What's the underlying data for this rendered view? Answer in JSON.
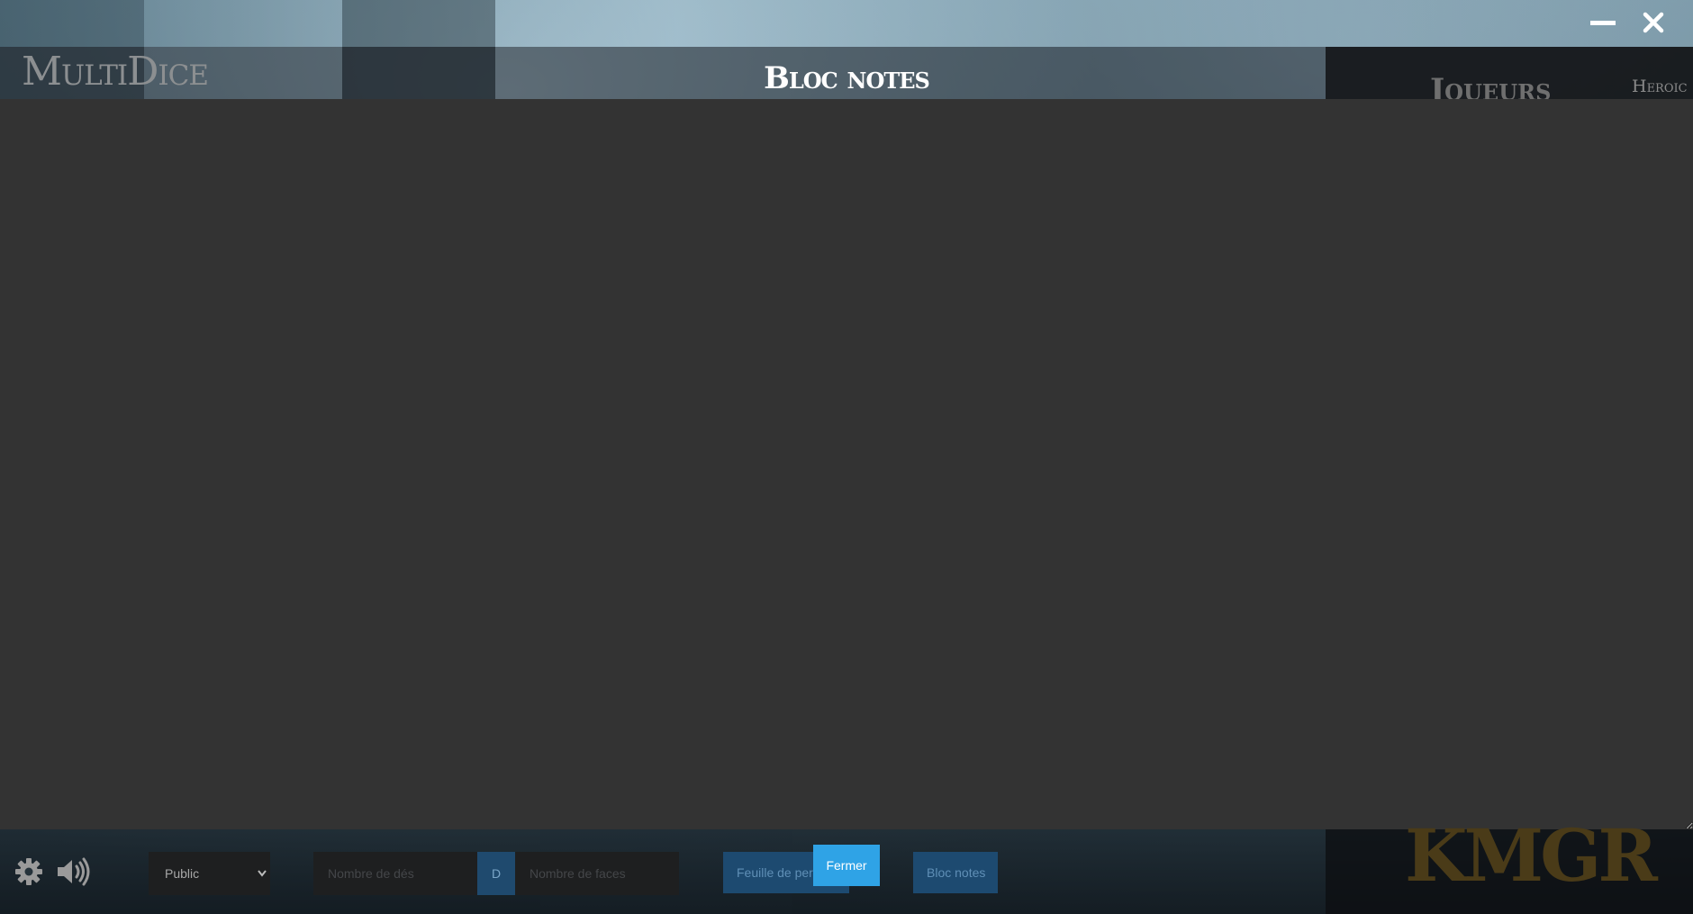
{
  "window": {
    "minimize_icon": "minimize-icon",
    "close_icon": "close-icon"
  },
  "header": {
    "logo": "MultiDice",
    "modal_title": "Bloc notes",
    "players_title": "Joueurs",
    "heroic_label": "Heroic"
  },
  "notes": {
    "value": ""
  },
  "bottom_bar": {
    "settings_icon": "gear-icon",
    "sound_icon": "speaker-volume-icon",
    "visibility_select": {
      "selected": "Public"
    },
    "dice_count_placeholder": "Nombre de dés",
    "dice_separator": "D",
    "faces_placeholder": "Nombre de faces",
    "sheet_button": "Feuille de personnage",
    "close_button": "Fermer",
    "notes_button": "Bloc notes"
  },
  "colors": {
    "notes_background": "#333333",
    "accent_blue": "#2fa3e6",
    "dark_blue": "#1d4a70"
  }
}
